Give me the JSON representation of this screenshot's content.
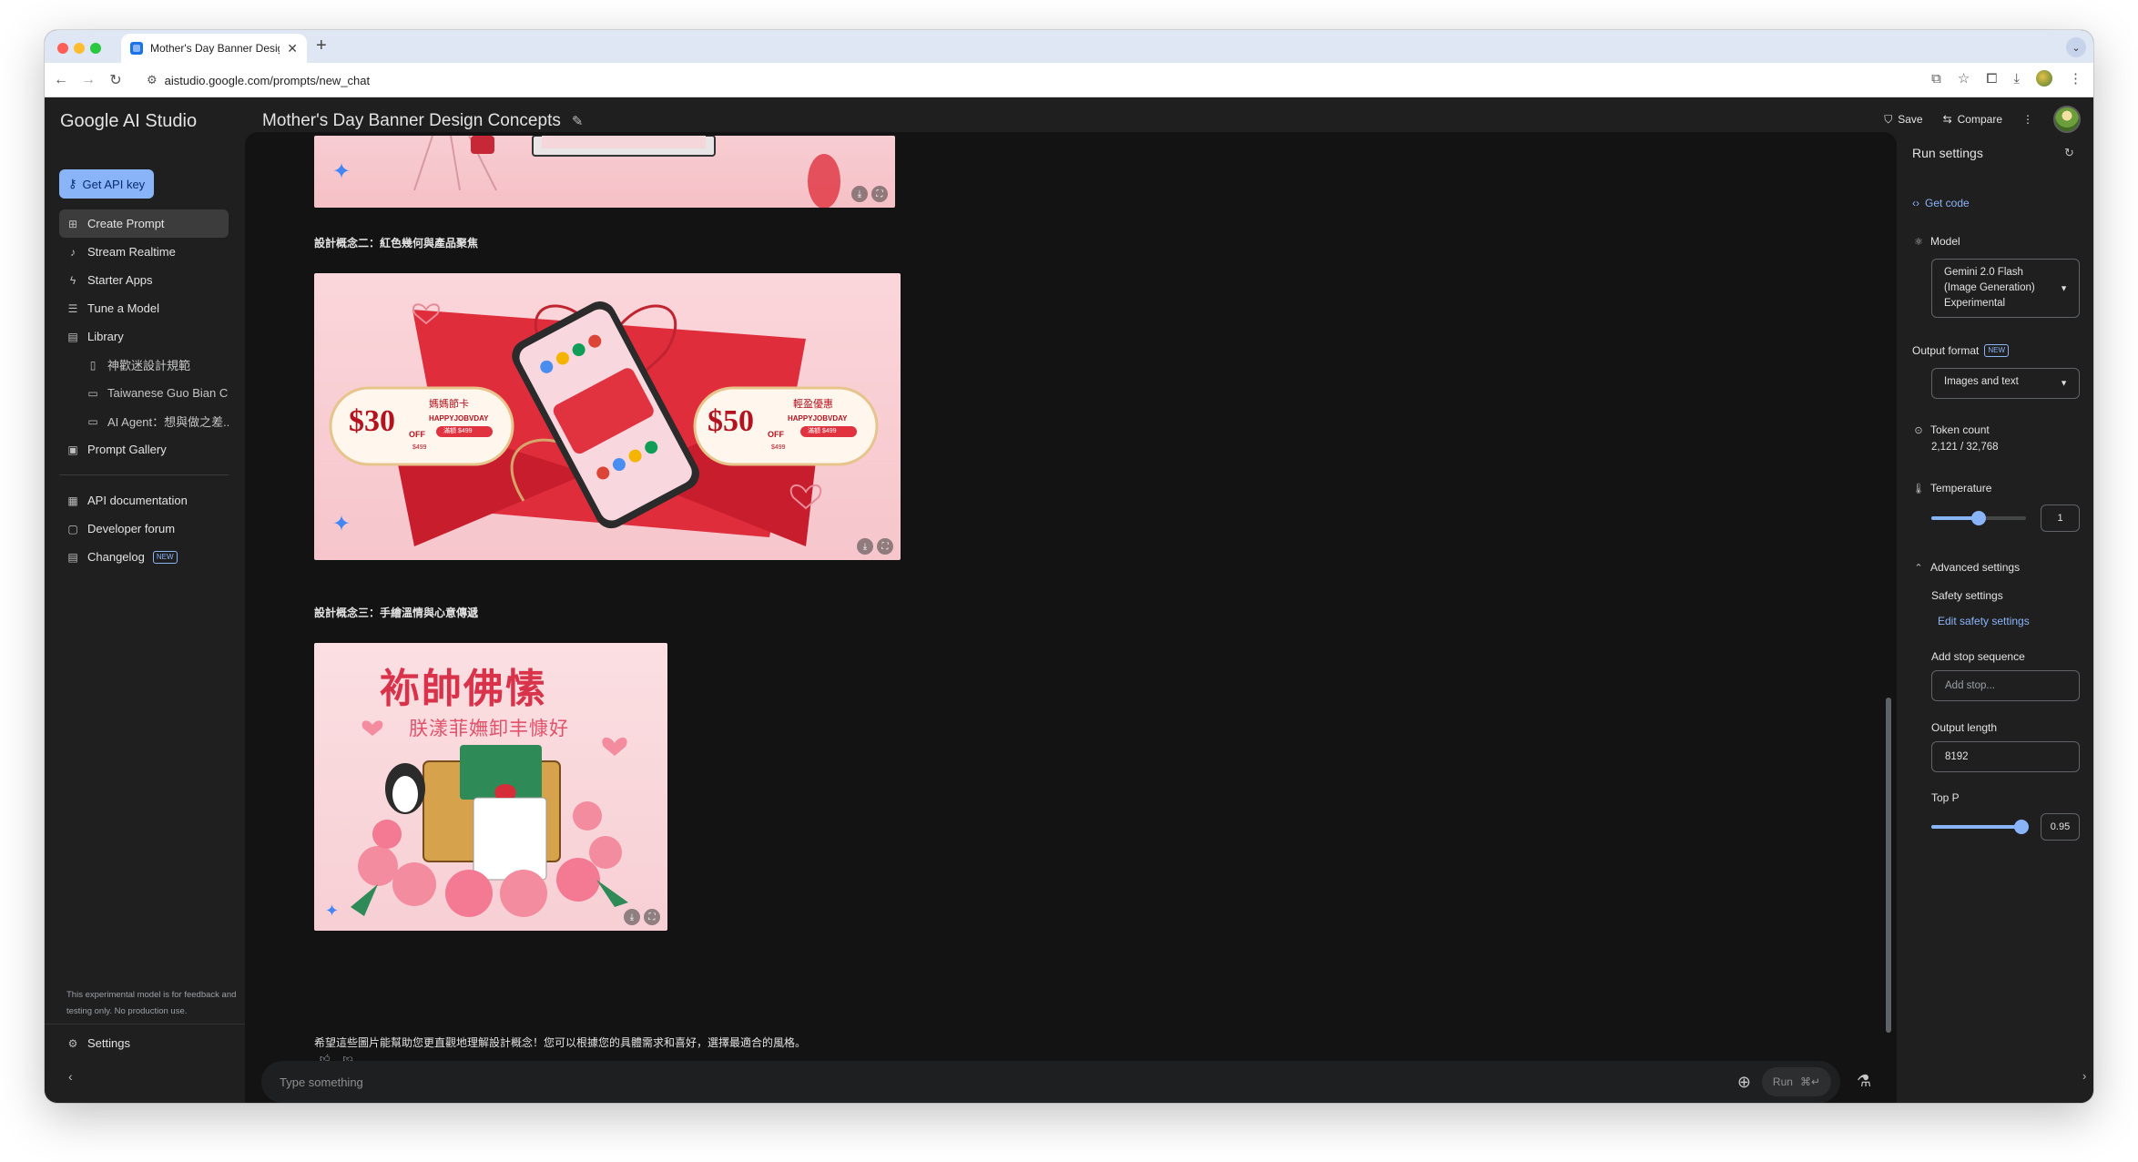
{
  "browser": {
    "tab_title": "Mother's Day Banner Design",
    "url": "aistudio.google.com/prompts/new_chat"
  },
  "sidebar": {
    "brand": "Google AI Studio",
    "api_key_button": "Get API key",
    "items": [
      {
        "label": "Create Prompt",
        "icon": "create-prompt-icon"
      },
      {
        "label": "Stream Realtime",
        "icon": "mic-icon"
      },
      {
        "label": "Starter Apps",
        "icon": "bolt-icon"
      },
      {
        "label": "Tune a Model",
        "icon": "tune-icon"
      },
      {
        "label": "Library",
        "icon": "library-icon"
      }
    ],
    "library_items": [
      {
        "label": "神歡迷設計規範",
        "icon": "document-icon"
      },
      {
        "label": "Taiwanese Guo Bian C...",
        "icon": "chat-icon"
      },
      {
        "label": "AI Agent：想與做之差...",
        "icon": "chat-icon"
      }
    ],
    "prompt_gallery": "Prompt Gallery",
    "resources": [
      {
        "label": "API documentation",
        "icon": "docs-icon"
      },
      {
        "label": "Developer forum",
        "icon": "forum-icon"
      },
      {
        "label": "Changelog",
        "icon": "changelog-icon"
      }
    ],
    "new_badge": "NEW",
    "disclaimer": "This experimental model is for feedback and testing only. No production use.",
    "settings": "Settings"
  },
  "header": {
    "title": "Mother's Day Banner Design Concepts",
    "save": "Save",
    "compare": "Compare"
  },
  "chat": {
    "concept2_label": "設計概念二：紅色幾何與產品聚焦",
    "concept3_label": "設計概念三：手繪溫情與心意傳遞",
    "final_message": "希望這些圖片能幫助您更直觀地理解設計概念！您可以根據您的具體需求和喜好，選擇最適合的風格。",
    "banner2": {
      "left_price": "$30",
      "right_price": "$50",
      "off": "OFF",
      "left_heading": "媽媽節卡",
      "right_heading": "輕盈優惠",
      "tagline": "HAPPYJOBVDAY",
      "pill_text": "滿額 $499",
      "sub_text": "$499"
    },
    "banner3": {
      "title": "袮帥佛愫",
      "subtitle": "朕漾菲嫵卸丰慷好"
    },
    "input_placeholder": "Type something",
    "run_label": "Run",
    "run_shortcut": "⌘↵"
  },
  "run_settings": {
    "title": "Run settings",
    "get_code": "Get code",
    "model_label": "Model",
    "model_value": [
      "Gemini 2.0 Flash",
      "(Image Generation)",
      "Experimental"
    ],
    "output_format_label": "Output format",
    "output_format_value": "Images and text",
    "token_count_label": "Token count",
    "token_count_value": "2,121 / 32,768",
    "temperature_label": "Temperature",
    "temperature_value": "1",
    "temperature_level": 0.5,
    "advanced_label": "Advanced settings",
    "safety_label": "Safety settings",
    "safety_link": "Edit safety settings",
    "stop_label": "Add stop sequence",
    "stop_placeholder": "Add stop...",
    "output_length_label": "Output length",
    "output_length_value": "8192",
    "top_p_label": "Top P",
    "top_p_value": "0.95",
    "top_p_level": 0.95
  },
  "colors": {
    "accent": "#8ab4f8",
    "background": "#1f1f1f",
    "chat_bg": "#131314"
  }
}
